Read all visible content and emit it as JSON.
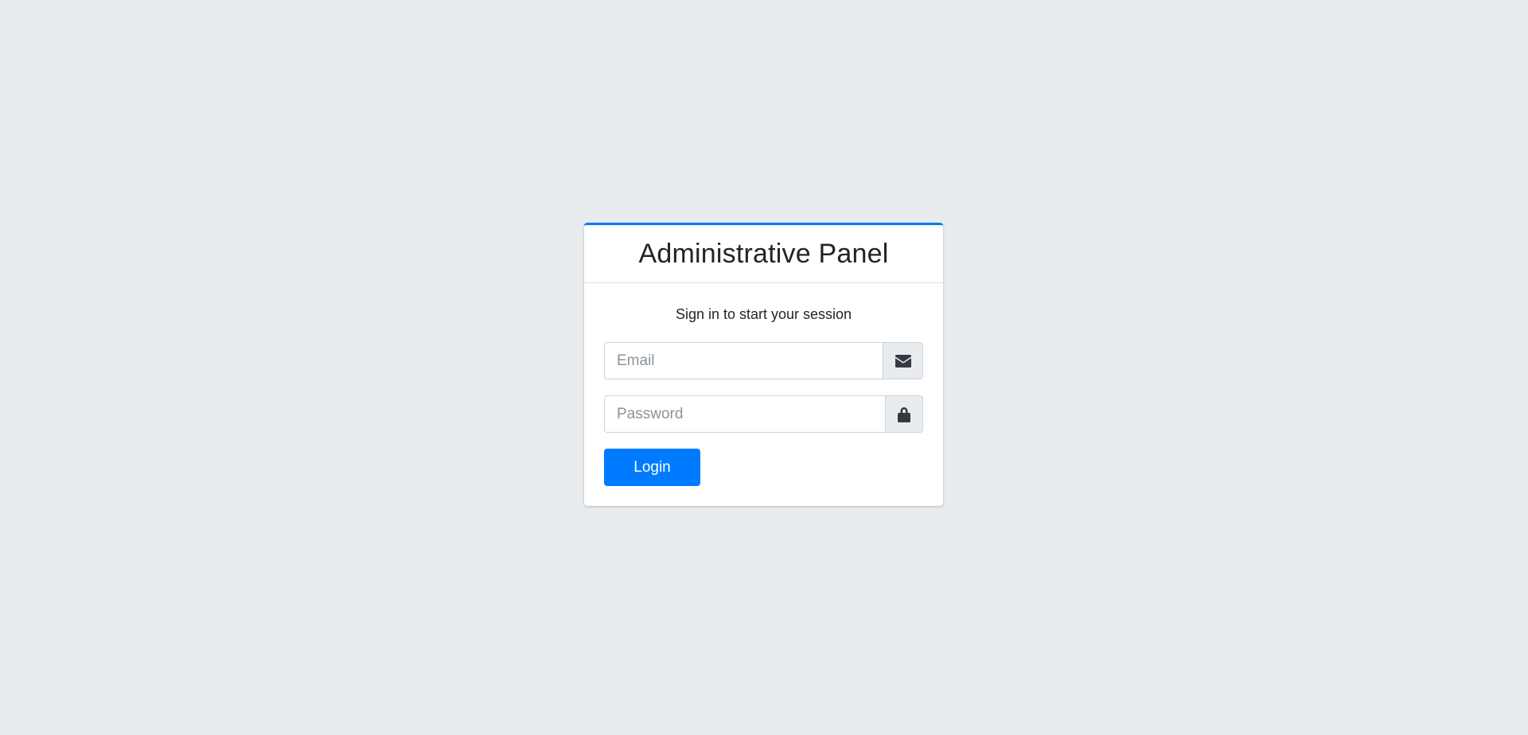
{
  "card": {
    "title": "Administrative Panel",
    "message": "Sign in to start your session"
  },
  "form": {
    "email": {
      "value": "",
      "placeholder": "Email",
      "icon": "envelope-icon"
    },
    "password": {
      "value": "",
      "placeholder": "Password",
      "icon": "lock-icon"
    },
    "login_label": "Login"
  },
  "colors": {
    "accent": "#007bff",
    "background": "#e9ecef"
  }
}
